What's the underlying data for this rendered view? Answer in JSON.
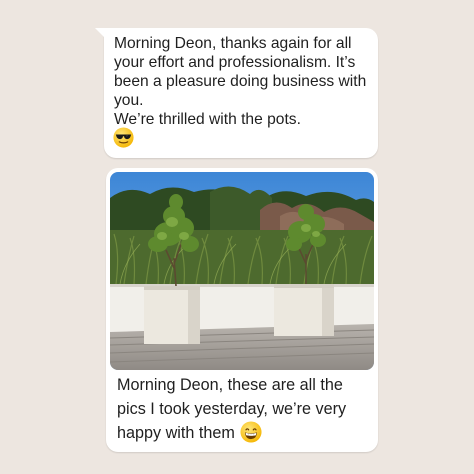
{
  "chat": {
    "message_1": {
      "text": "Morning Deon, thanks again for all your effort and professionalism. It’s been a pleasure doing business with you.\nWe’re thrilled with the pots.",
      "emoji": "sunglasses-emoji",
      "bubble_color": "#ffffff"
    },
    "message_2": {
      "image": "photo-of-two-white-planters-on-deck",
      "caption": "Morning Deon, these are all the pics I took yesterday, we’re very happy with them",
      "emoji": "grinning-emoji"
    }
  },
  "theme": {
    "background": "#ede6e0",
    "bubble": "#ffffff",
    "text": "#1f1f1f"
  }
}
